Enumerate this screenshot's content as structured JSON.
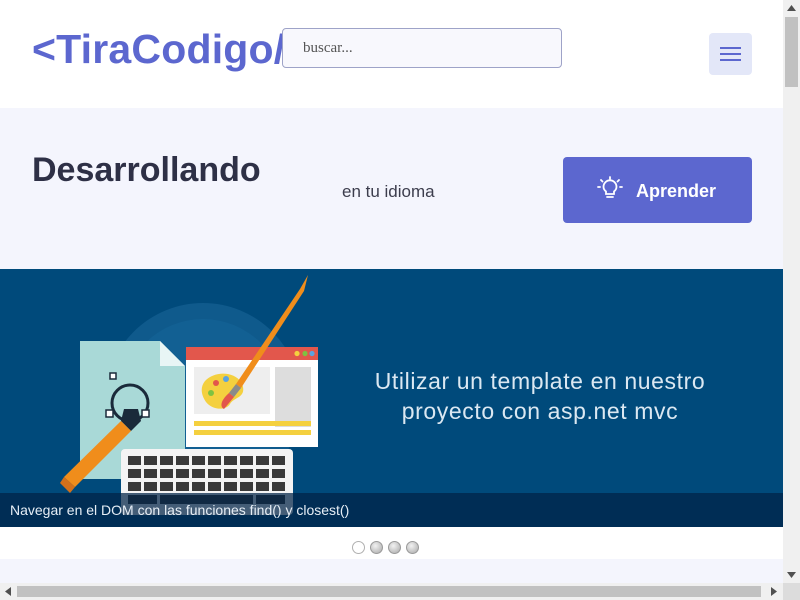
{
  "header": {
    "logo_text": "<TiraCodigo/>",
    "search_placeholder": "buscar...",
    "menu_icon": "hamburger-icon"
  },
  "hero": {
    "title": "Desarrollando",
    "subtitle": "en tu idioma",
    "button_label": "Aprender",
    "button_icon": "lightbulb-icon"
  },
  "carousel": {
    "slide_headline_line1": "Utilizar un template en nuestro",
    "slide_headline_line2": "proyecto con asp.net mvc",
    "caption": "Navegar en el DOM con las funciones find() y closest()",
    "slide_count": 4,
    "active_index": 0
  },
  "scrollbars": {
    "vertical_position": 0,
    "horizontal_position": 0
  },
  "colors": {
    "accent": "#5c67cf",
    "hero_bg": "#f4f5fd",
    "slide_bg": "#004a7b"
  }
}
